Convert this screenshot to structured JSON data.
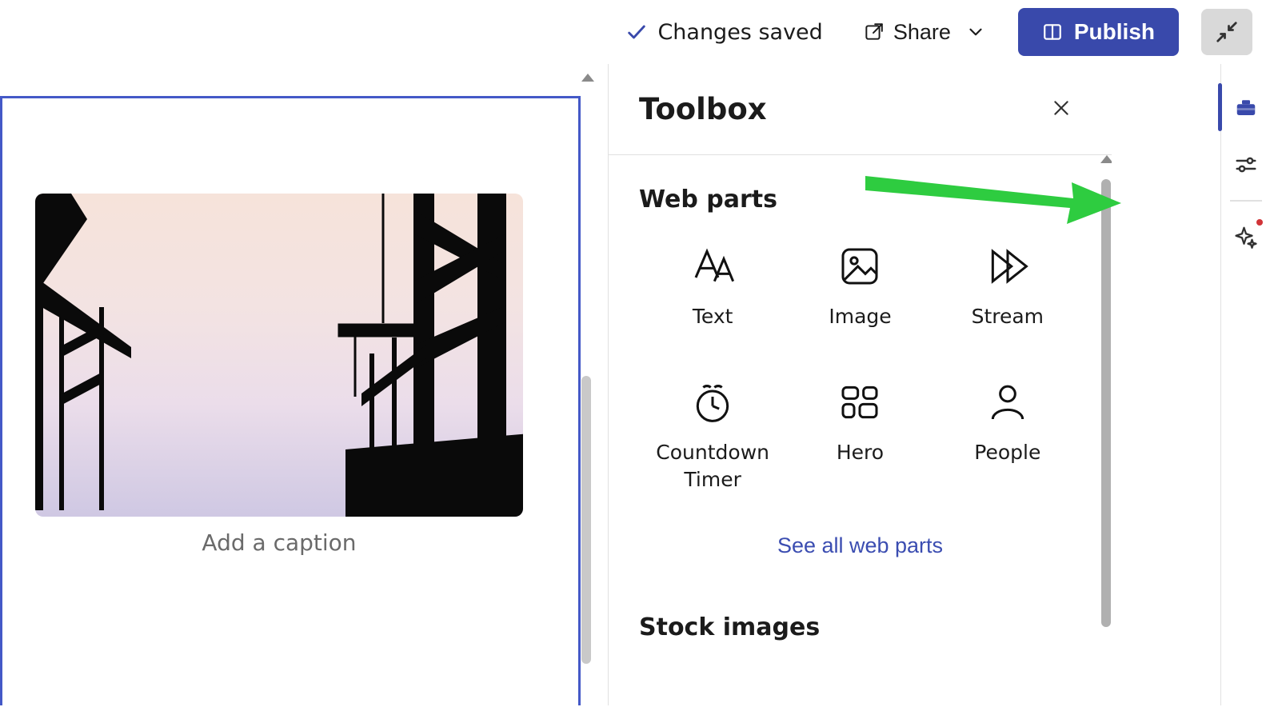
{
  "topbar": {
    "save_status": "Changes saved",
    "share_label": "Share",
    "publish_label": "Publish"
  },
  "canvas": {
    "caption_placeholder": "Add a caption"
  },
  "toolbox": {
    "title": "Toolbox",
    "section_webparts": "Web parts",
    "section_stock": "Stock images",
    "see_all": "See all web parts",
    "items": [
      {
        "label": "Text"
      },
      {
        "label": "Image"
      },
      {
        "label": "Stream"
      },
      {
        "label": "Countdown Timer"
      },
      {
        "label": "Hero"
      },
      {
        "label": "People"
      }
    ]
  }
}
